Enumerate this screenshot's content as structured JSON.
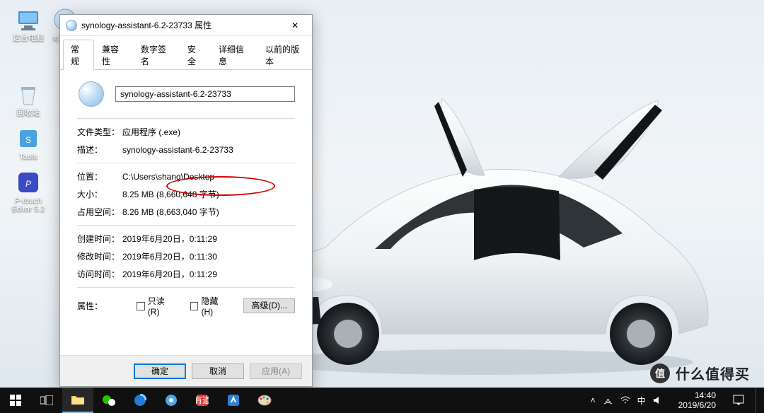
{
  "desktop": {
    "icons": [
      {
        "label": "这台电脑",
        "name": "this-pc"
      },
      {
        "label": "synol...",
        "name": "synology-file"
      },
      {
        "label": "回收站",
        "name": "recycle-bin"
      },
      {
        "label": "Tools",
        "name": "tools-folder"
      },
      {
        "label": "P-touch\nEditor 5.2",
        "name": "ptouch-editor"
      }
    ]
  },
  "dialog": {
    "title": "synology-assistant-6.2-23733 属性",
    "close_glyph": "✕",
    "tabs": [
      {
        "label": "常规",
        "active": true
      },
      {
        "label": "兼容性",
        "active": false
      },
      {
        "label": "数字签名",
        "active": false
      },
      {
        "label": "安全",
        "active": false
      },
      {
        "label": "详细信息",
        "active": false
      },
      {
        "label": "以前的版本",
        "active": false
      }
    ],
    "filename": "synology-assistant-6.2-23733",
    "rows": {
      "type_label": "文件类型：",
      "type_value": "应用程序 (.exe)",
      "desc_label": "描述：",
      "desc_value": "synology-assistant-6.2-23733",
      "loc_label": "位置：",
      "loc_value": "C:\\Users\\shang\\Desktop",
      "size_label": "大小：",
      "size_value": "8.25 MB (8,660,648 字节)",
      "disk_label": "占用空间：",
      "disk_value": "8.26 MB (8,663,040 字节)",
      "created_label": "创建时间：",
      "created_value": "2019年6月20日，0:11:29",
      "modified_label": "修改时间：",
      "modified_value": "2019年6月20日，0:11:30",
      "accessed_label": "访问时间：",
      "accessed_value": "2019年6月20日，0:11:29",
      "attr_label": "属性：",
      "readonly_label": "只读(R)",
      "hidden_label": "隐藏(H)",
      "advanced_label": "高级(D)..."
    },
    "buttons": {
      "ok": "确定",
      "cancel": "取消",
      "apply": "应用(A)"
    }
  },
  "taskbar": {
    "time": "14:40",
    "date": "2019/6/20",
    "ime": "中"
  },
  "watermark": {
    "logo": "值",
    "text": "什么值得买"
  }
}
